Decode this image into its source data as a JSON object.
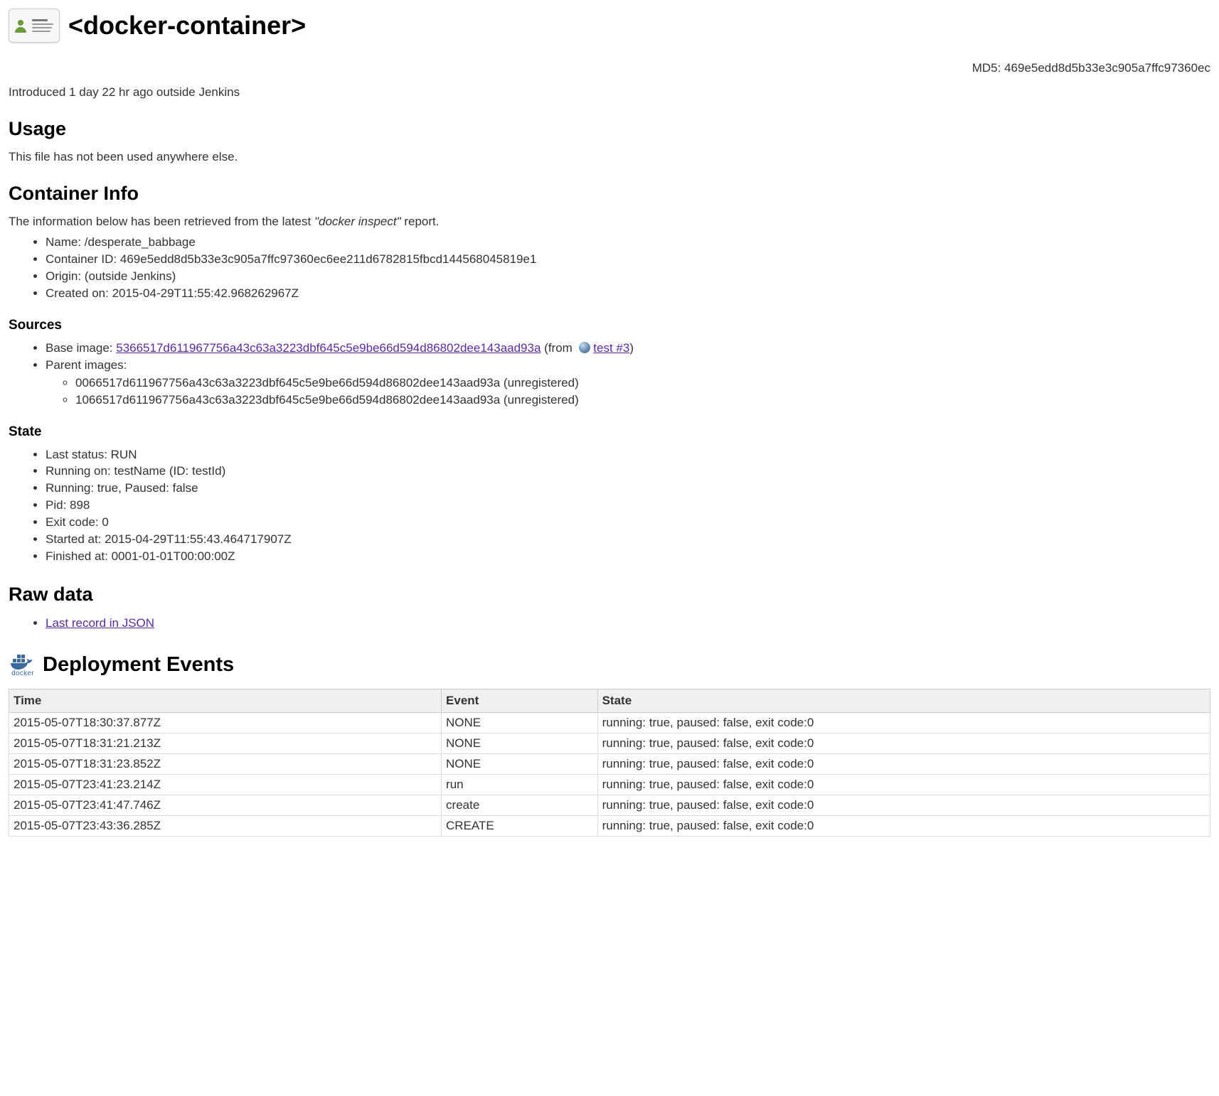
{
  "header": {
    "title": "<docker-container>"
  },
  "md5_label": "MD5: ",
  "md5_value": "469e5edd8d5b33e3c905a7ffc97360ec",
  "introduced": "Introduced 1 day 22 hr ago outside Jenkins",
  "usage": {
    "heading": "Usage",
    "body": "This file has not been used anywhere else."
  },
  "container_info": {
    "heading": "Container Info",
    "intro_prefix": "The information below has been retrieved from the latest ",
    "intro_quoted": "\"docker inspect\"",
    "intro_suffix": " report.",
    "items": {
      "name_label": "Name: ",
      "name_value": "/desperate_babbage",
      "id_label": "Container ID: ",
      "id_value": "469e5edd8d5b33e3c905a7ffc97360ec6ee211d6782815fbcd144568045819e1",
      "origin_label": "Origin: ",
      "origin_value": "(outside Jenkins)",
      "created_label": "Created on: ",
      "created_value": "2015-04-29T11:55:42.968262967Z"
    }
  },
  "sources": {
    "heading": "Sources",
    "base_label": "Base image: ",
    "base_link": "5366517d611967756a43c63a3223dbf645c5e9be66d594d86802dee143aad93a",
    "base_from_prefix": " (from ",
    "base_from_link": "test #3",
    "base_from_suffix": ")",
    "parent_label": "Parent images:",
    "parents": [
      "0066517d611967756a43c63a3223dbf645c5e9be66d594d86802dee143aad93a (unregistered)",
      "1066517d611967756a43c63a3223dbf645c5e9be66d594d86802dee143aad93a (unregistered)"
    ]
  },
  "state": {
    "heading": "State",
    "items": [
      "Last status: RUN",
      "Running on: testName (ID: testId)",
      "Running: true, Paused: false",
      "Pid: 898",
      "Exit code: 0",
      "Started at: 2015-04-29T11:55:43.464717907Z",
      "Finished at: 0001-01-01T00:00:00Z"
    ]
  },
  "raw_data": {
    "heading": "Raw data",
    "link": "Last record in JSON"
  },
  "deployment_events": {
    "heading": "Deployment Events",
    "docker_label": "docker",
    "columns": [
      "Time",
      "Event",
      "State"
    ],
    "rows": [
      {
        "time": "2015-05-07T18:30:37.877Z",
        "event": "NONE",
        "state": "running: true, paused: false, exit code:0"
      },
      {
        "time": "2015-05-07T18:31:21.213Z",
        "event": "NONE",
        "state": "running: true, paused: false, exit code:0"
      },
      {
        "time": "2015-05-07T18:31:23.852Z",
        "event": "NONE",
        "state": "running: true, paused: false, exit code:0"
      },
      {
        "time": "2015-05-07T23:41:23.214Z",
        "event": "run",
        "state": "running: true, paused: false, exit code:0"
      },
      {
        "time": "2015-05-07T23:41:47.746Z",
        "event": "create",
        "state": "running: true, paused: false, exit code:0"
      },
      {
        "time": "2015-05-07T23:43:36.285Z",
        "event": "CREATE",
        "state": "running: true, paused: false, exit code:0"
      }
    ]
  }
}
